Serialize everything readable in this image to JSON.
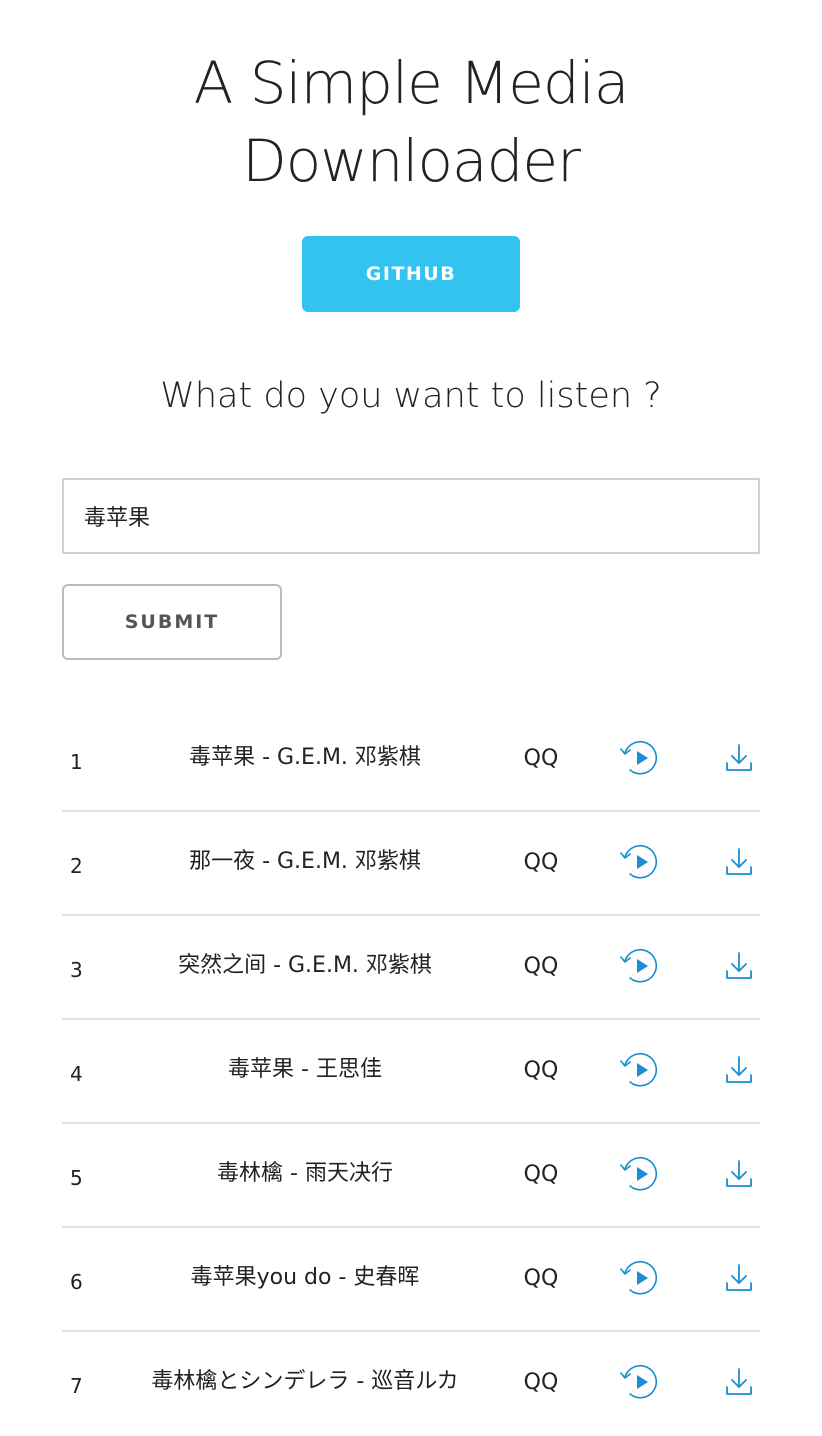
{
  "header": {
    "title_line1": "A Simple Media",
    "title_line2": "Downloader",
    "github_label": "GITHUB"
  },
  "search": {
    "question": "What do you want to listen ?",
    "value": "毒苹果",
    "submit_label": "SUBMIT"
  },
  "colors": {
    "accent": "#33c3f0",
    "icon": "#1a8ed1"
  },
  "icons": {
    "play": "play-circle-icon",
    "download": "download-icon"
  },
  "results": [
    {
      "num": "1",
      "song": "毒苹果 - G.E.M. 邓紫棋",
      "source": "QQ"
    },
    {
      "num": "2",
      "song": "那一夜 - G.E.M. 邓紫棋",
      "source": "QQ"
    },
    {
      "num": "3",
      "song": "突然之间 - G.E.M. 邓紫棋",
      "source": "QQ"
    },
    {
      "num": "4",
      "song": "毒苹果 - 王思佳",
      "source": "QQ"
    },
    {
      "num": "5",
      "song": "毒林檎 - 雨天决行",
      "source": "QQ"
    },
    {
      "num": "6",
      "song": "毒苹果you do - 史春晖",
      "source": "QQ"
    },
    {
      "num": "7",
      "song": "毒林檎とシンデレラ - 巡音ルカ",
      "source": "QQ"
    }
  ]
}
